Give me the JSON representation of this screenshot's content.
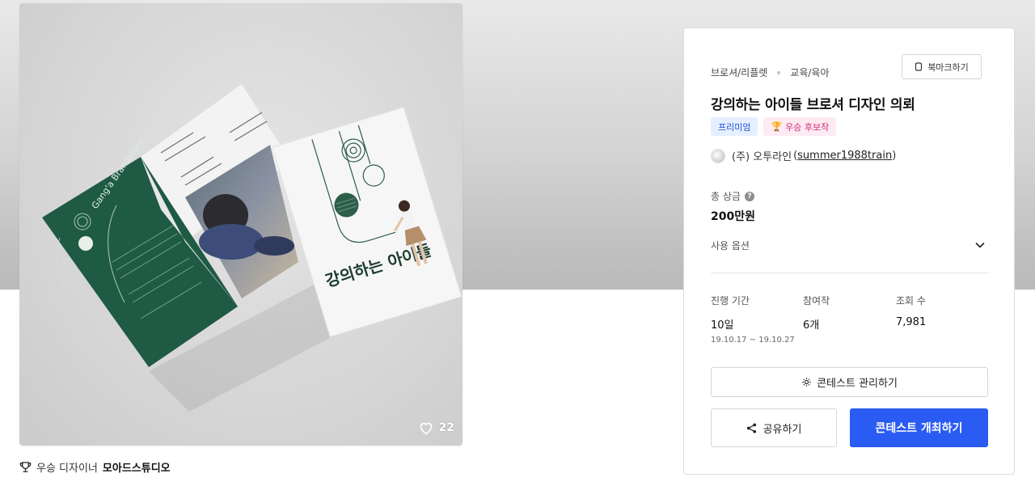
{
  "gallery": {
    "likes": "22",
    "designer_prefix": "우승 디자이너",
    "designer_name": "모아드스튜디오",
    "brochure_cover_text": "강의하는 아이들",
    "brochure_inner_text": "Gang'a Brandstory"
  },
  "contest": {
    "category": "브로셔/리플렛",
    "subcategory": "교육/육아",
    "bookmark_label": "북마크하기",
    "title": "강의하는 아이들 브로셔 디자인 의뢰",
    "badges": [
      "프리미엄",
      "우승 후보작"
    ],
    "host_name": "(주) 오투라인",
    "host_open_paren": "(",
    "host_id": "summer1988train",
    "host_close_paren": ")",
    "prize_label": "총 상금",
    "prize_help": "?",
    "prize_value": "200만원",
    "usage_label": "사용 옵션",
    "stats": {
      "duration_label": "진행 기간",
      "duration_value": "10일",
      "duration_range": "19.10.17 ~ 19.10.27",
      "entries_label": "참여작",
      "entries_value": "6개",
      "views_label": "조회 수",
      "views_value": "7,981"
    },
    "manage_label": "콘테스트 관리하기",
    "share_label": "공유하기",
    "host_contest_label": "콘테스트 개최하기"
  },
  "colors": {
    "primary": "#2a5bf2",
    "premium_badge_bg": "#e6efff",
    "premium_badge_text": "#1f50d6",
    "award_badge_bg": "#fdeaf3",
    "award_badge_text": "#d22e79",
    "brochure_green": "#1f5a44"
  },
  "icons": [
    "heart-icon",
    "trophy-icon",
    "bookmark-icon",
    "help-icon",
    "chevron-down-icon",
    "gear-icon",
    "share-icon"
  ]
}
